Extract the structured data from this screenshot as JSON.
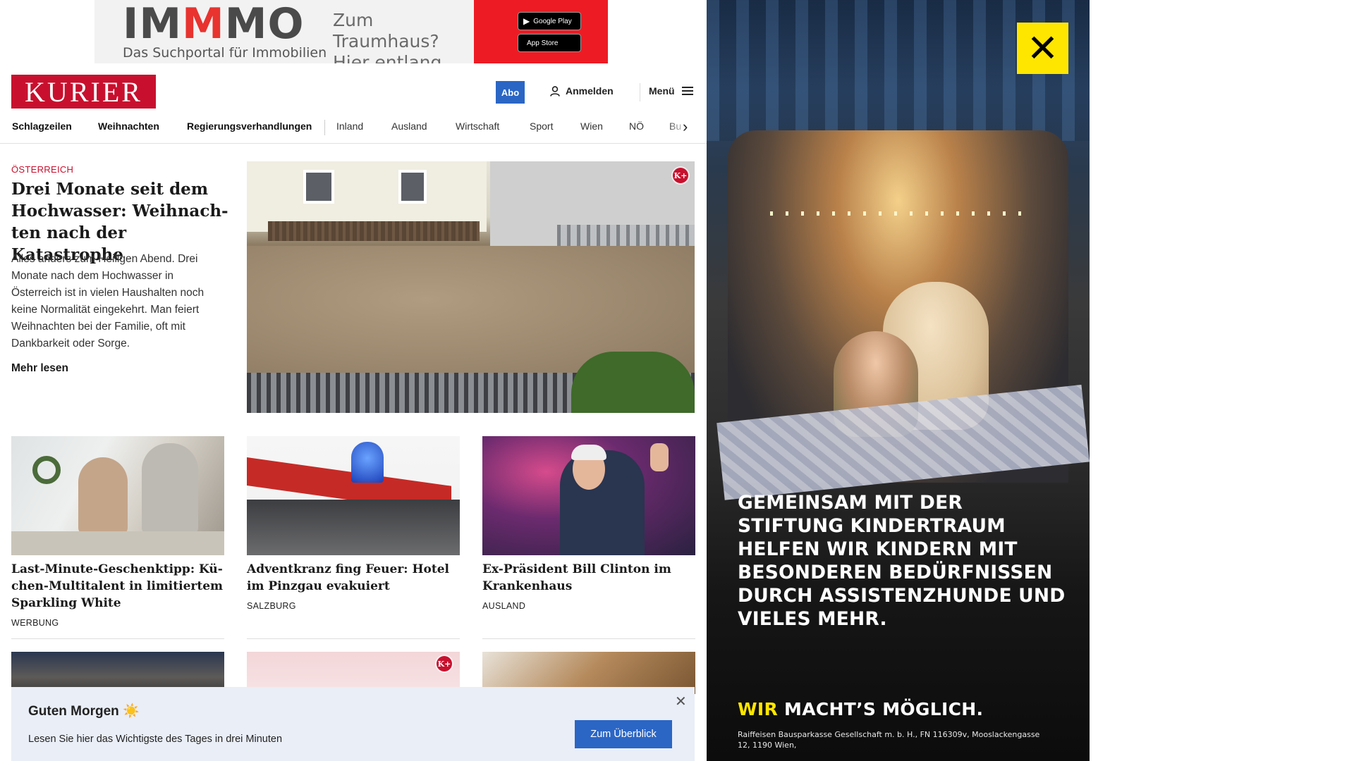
{
  "top_ad": {
    "brand": "IMMMO",
    "brand_prefix": "IM",
    "brand_accent": "M",
    "brand_suffix": "MO",
    "tagline": "Das Suchportal für Immobilien",
    "slogan_line1": "Zum Traumhaus?",
    "slogan_line2": "Hier entlang.",
    "google_play": "Google Play",
    "app_store": "App Store",
    "accent_color": "#ed1c24"
  },
  "header": {
    "logo": "KURIER",
    "abo": "Abo",
    "login": "Anmelden",
    "menu": "Menü",
    "brand_color": "#c8102e",
    "button_color": "#2b66c5"
  },
  "nav": {
    "items": [
      "Schlagzeilen",
      "Weihnachten",
      "Regierungsverhandlungen",
      "Inland",
      "Ausland",
      "Wirtschaft",
      "Sport",
      "Wien",
      "NÖ",
      "Bu"
    ]
  },
  "lead": {
    "kicker": "ÖSTERREICH",
    "title": "Drei Monate seit dem Hochwasser: Weihnach­ten nach der Katastrophe",
    "teaser": "Alles anders zum Heiligen Abend. Drei Monate nach dem Hochwasser in Österreich ist in vielen Haushalten noch keine Normalität eingekehrt. Man feiert Weihnachten bei der Familie, oft mit Dankbarkeit oder Sorge.",
    "more": "Mehr lesen",
    "badge": "K+"
  },
  "cards": [
    {
      "title": "Last-Minute-Geschenktipp: Kü­chen-Multitalent in limitiertem Sparkling White",
      "tag": "WERBUNG"
    },
    {
      "title": "Adventkranz fing Feuer: Hotel im Pinzgau evakuiert",
      "tag": "SALZBURG"
    },
    {
      "title": "Ex-Präsident Bill Clinton im Krankenhaus",
      "tag": "AUSLAND"
    }
  ],
  "row2_badge": "K+",
  "newsletter": {
    "title": "Guten Morgen ☀️",
    "text": "Lesen Sie hier das Wichtigste des Tages in drei Minuten",
    "button": "Zum Überblick",
    "close": "✕"
  },
  "side_ad": {
    "logo_icon": "raiffeisen-gable-cross",
    "headline": "GEMEINSAM MIT DER STIFTUNG KINDERTRAUM HELFEN WIR KINDERN MIT BESONDEREN BEDÜRFNISSEN DURCH ASSISTENZHUNDE UND VIELES MEHR.",
    "claim_accent": "WIR",
    "claim_rest": "MACHT’S MÖGLICH.",
    "legal": "Raiffeisen Bausparkasse Gesellschaft m. b. H., FN 116309v, Mooslackengasse 12, 1190 Wien,",
    "accent_color": "#ffe600"
  }
}
